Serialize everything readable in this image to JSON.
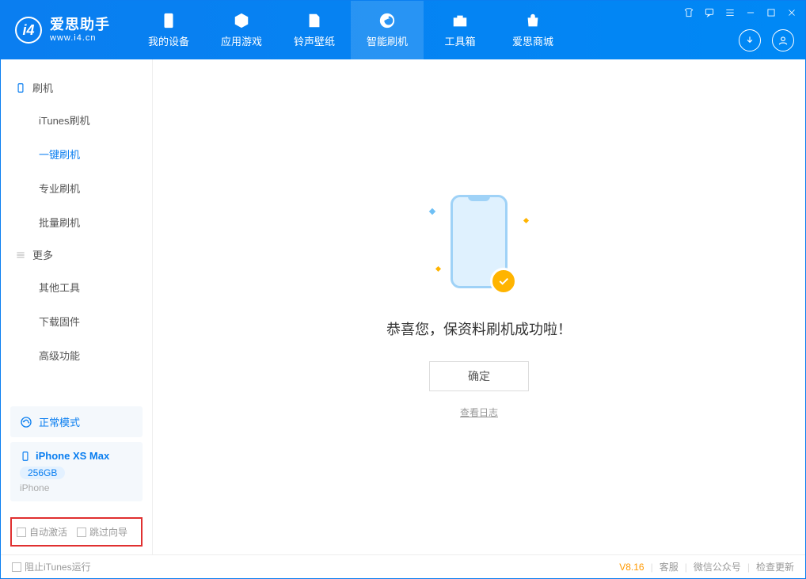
{
  "app": {
    "title": "爱思助手",
    "subtitle": "www.i4.cn"
  },
  "tabs": [
    {
      "label": "我的设备"
    },
    {
      "label": "应用游戏"
    },
    {
      "label": "铃声壁纸"
    },
    {
      "label": "智能刷机"
    },
    {
      "label": "工具箱"
    },
    {
      "label": "爱思商城"
    }
  ],
  "sidebar": {
    "section1": {
      "title": "刷机",
      "items": [
        "iTunes刷机",
        "一键刷机",
        "专业刷机",
        "批量刷机"
      ]
    },
    "section2": {
      "title": "更多",
      "items": [
        "其他工具",
        "下载固件",
        "高级功能"
      ]
    },
    "mode": "正常模式",
    "device": {
      "name": "iPhone XS Max",
      "storage": "256GB",
      "type": "iPhone"
    },
    "checks": {
      "auto_activate": "自动激活",
      "skip_guide": "跳过向导"
    }
  },
  "main": {
    "message": "恭喜您，保资料刷机成功啦！",
    "ok": "确定",
    "view_log": "查看日志"
  },
  "footer": {
    "block_itunes": "阻止iTunes运行",
    "version": "V8.16",
    "support": "客服",
    "wechat": "微信公众号",
    "check_update": "检查更新"
  }
}
